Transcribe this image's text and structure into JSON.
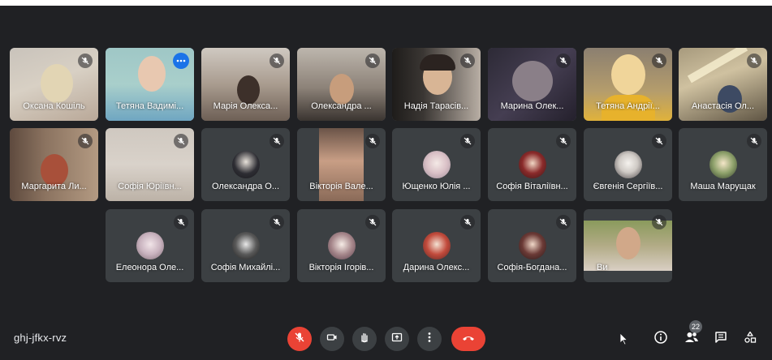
{
  "meeting": {
    "code": "ghj-jfkx-rvz",
    "participant_count": "22"
  },
  "participants": [
    "Оксана Кошіль",
    "Тетяна Вадимі...",
    "Марія Олекса...",
    "Олександра ...",
    "Надія Тарасів...",
    "Марина Олек...",
    "Тетяна Андрії...",
    "Анастасія Ол...",
    "Маргарита Ли...",
    "Софія Юріївн...",
    "Олександра О...",
    "Вікторія Вале...",
    "Ющенко Юлія ...",
    "Софія Віталіївн...",
    "Євгенія Сергіїв...",
    "Маша Марущак",
    "Елеонора Оле...",
    "Софія Михайлі...",
    "Вікторія Ігорів...",
    "Дарина Олекс...",
    "Софія-Богдана...",
    "Ви"
  ],
  "icons": {
    "mic": "mic-off-icon",
    "camera": "camera-icon",
    "hand": "raise-hand-icon",
    "present": "present-icon",
    "more": "more-vert-icon",
    "end": "end-call-icon",
    "info": "info-icon",
    "people": "people-icon",
    "chat": "chat-icon",
    "activities": "activities-icon",
    "cursor": "cursor-icon"
  },
  "colors": {
    "background": "#202124",
    "tile": "#3c4043",
    "danger": "#ea4335",
    "accent": "#1a73e8"
  }
}
